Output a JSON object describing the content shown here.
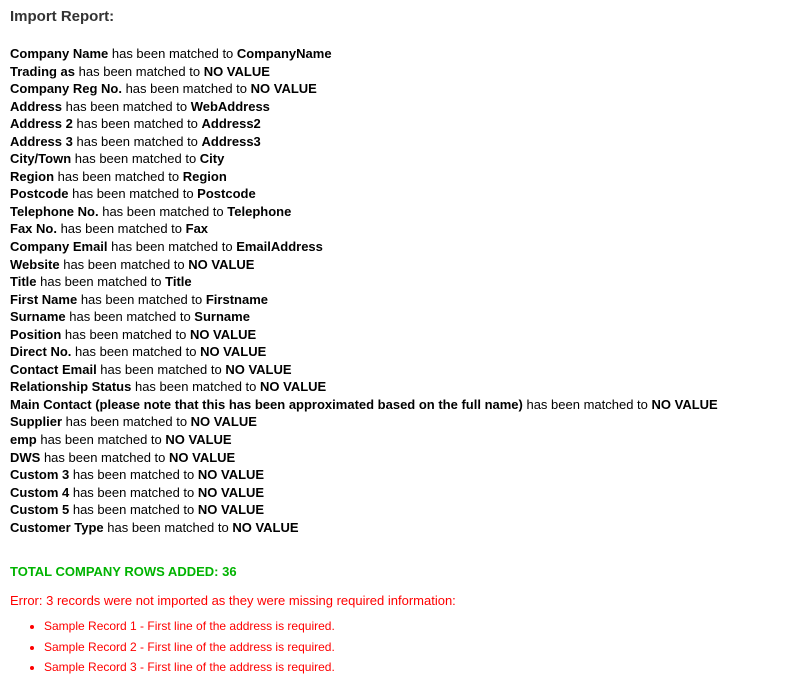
{
  "title": "Import Report:",
  "match_phrase": " has been matched to ",
  "mappings": [
    {
      "source": "Company Name",
      "target": "CompanyName"
    },
    {
      "source": "Trading as",
      "target": "NO VALUE"
    },
    {
      "source": "Company Reg No.",
      "target": "NO VALUE"
    },
    {
      "source": "Address",
      "target": "WebAddress"
    },
    {
      "source": "Address 2",
      "target": "Address2"
    },
    {
      "source": "Address 3",
      "target": "Address3"
    },
    {
      "source": "City/Town",
      "target": "City"
    },
    {
      "source": "Region",
      "target": "Region"
    },
    {
      "source": "Postcode",
      "target": "Postcode"
    },
    {
      "source": "Telephone No.",
      "target": "Telephone"
    },
    {
      "source": "Fax No.",
      "target": "Fax"
    },
    {
      "source": "Company Email",
      "target": "EmailAddress"
    },
    {
      "source": "Website",
      "target": "NO VALUE"
    },
    {
      "source": "Title",
      "target": "Title"
    },
    {
      "source": "First Name",
      "target": "Firstname"
    },
    {
      "source": "Surname",
      "target": "Surname"
    },
    {
      "source": "Position",
      "target": "NO VALUE"
    },
    {
      "source": "Direct No.",
      "target": "NO VALUE"
    },
    {
      "source": "Contact Email",
      "target": "NO VALUE"
    },
    {
      "source": "Relationship Status",
      "target": "NO VALUE"
    },
    {
      "source": "Main Contact (please note that this has been approximated based on the full name)",
      "target": "NO VALUE"
    },
    {
      "source": "Supplier",
      "target": "NO VALUE"
    },
    {
      "source": "emp",
      "target": "NO VALUE"
    },
    {
      "source": "DWS",
      "target": "NO VALUE"
    },
    {
      "source": "Custom 3",
      "target": "NO VALUE"
    },
    {
      "source": "Custom 4",
      "target": "NO VALUE"
    },
    {
      "source": "Custom 5",
      "target": "NO VALUE"
    },
    {
      "source": "Customer Type",
      "target": "NO VALUE"
    }
  ],
  "total_line": "TOTAL COMPANY ROWS ADDED: 36",
  "error_heading": "Error: 3 records were not imported as they were missing required information:",
  "error_records": [
    "Sample Record 1 - First line of the address is required.",
    "Sample Record 2 - First line of the address is required.",
    "Sample Record 3 - First line of the address is required."
  ]
}
